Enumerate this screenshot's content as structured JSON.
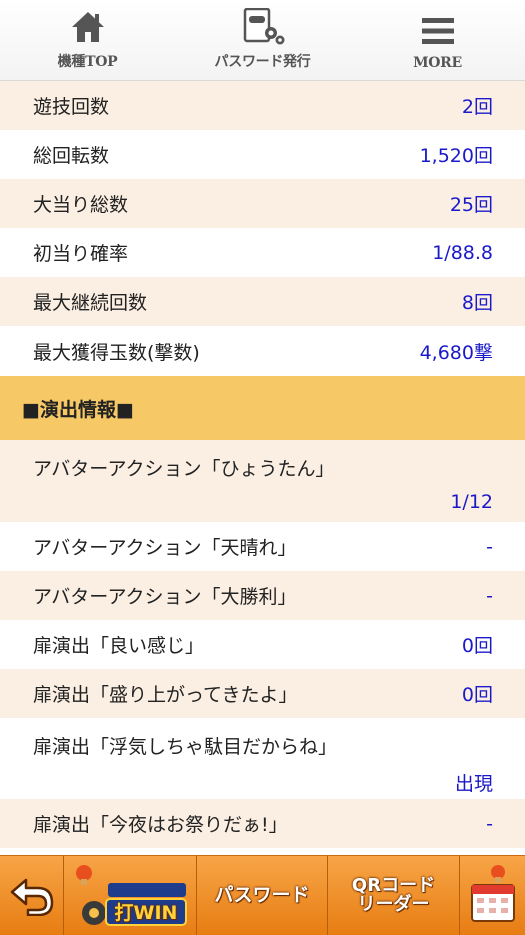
{
  "nav": [
    {
      "label": "機種TOP",
      "icon": "home-icon"
    },
    {
      "label": "パスワード発行",
      "icon": "password-document-icon"
    },
    {
      "label": "MORE",
      "icon": "menu-icon"
    }
  ],
  "stats": [
    {
      "label": "遊技回数",
      "value": "2回"
    },
    {
      "label": "総回転数",
      "value": "1,520回"
    },
    {
      "label": "大当り総数",
      "value": "25回"
    },
    {
      "label": "初当り確率",
      "value": "1/88.8"
    },
    {
      "label": "最大継続回数",
      "value": "8回"
    },
    {
      "label": "最大獲得玉数(撃数)",
      "value": "4,680撃"
    }
  ],
  "section_title": "■演出情報■",
  "effects": [
    {
      "label": "アバターアクション「ひょうたん」",
      "value": "1/12"
    },
    {
      "label": "アバターアクション「天晴れ」",
      "value": "-"
    },
    {
      "label": "アバターアクション「大勝利」",
      "value": "-"
    },
    {
      "label": "扉演出「良い感じ」",
      "value": "0回"
    },
    {
      "label": "扉演出「盛り上がってきたよ」",
      "value": "0回"
    },
    {
      "label": "扉演出「浮気しちゃ駄目だからね」",
      "value": "出現"
    },
    {
      "label": "扉演出「今夜はお祭りだぁ!」",
      "value": "-"
    }
  ],
  "toolbar": {
    "back_icon": "back-arrow-icon",
    "logo_text": "打WIN",
    "password_label": "パスワード",
    "qr_line1": "QRコード",
    "qr_line2": "リーダー",
    "calendar_icon": "calendar-icon"
  },
  "colors": {
    "value_blue": "#1a1ac8",
    "row_beige": "#fbefe3",
    "section_yellow": "#f6c866",
    "toolbar_orange": "#f29331"
  }
}
